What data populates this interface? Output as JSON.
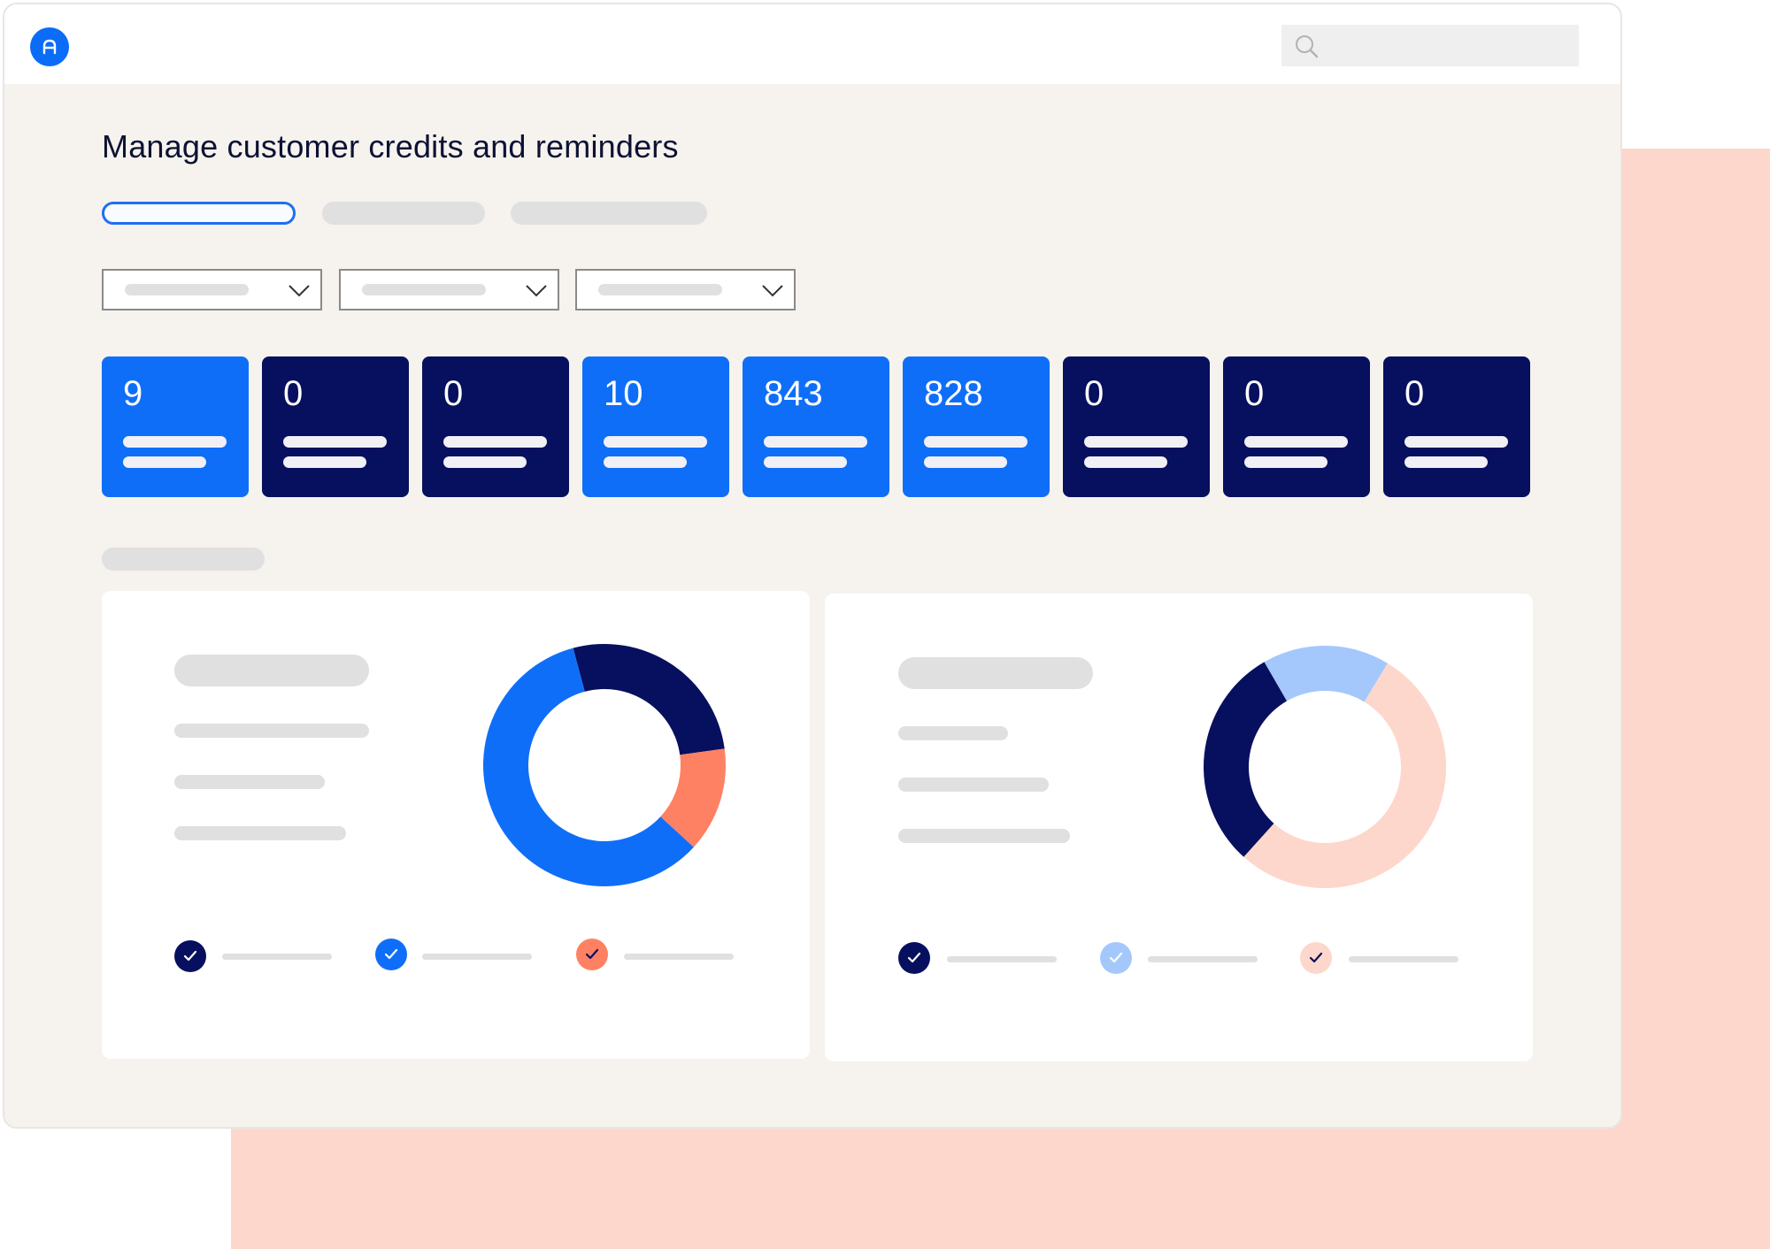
{
  "page": {
    "title": "Manage customer credits and reminders"
  },
  "topbar": {
    "logo_icon": "a-logo-icon",
    "search_icon": "search-icon"
  },
  "tabs": [
    {
      "active": true
    },
    {
      "active": false
    },
    {
      "active": false
    }
  ],
  "filters": [
    {
      "icon": "chevron-down-icon"
    },
    {
      "icon": "chevron-down-icon"
    },
    {
      "icon": "chevron-down-icon"
    }
  ],
  "kpis": [
    {
      "value": "9",
      "tone": "light"
    },
    {
      "value": "0",
      "tone": "dark"
    },
    {
      "value": "0",
      "tone": "dark"
    },
    {
      "value": "10",
      "tone": "light"
    },
    {
      "value": "843",
      "tone": "light"
    },
    {
      "value": "828",
      "tone": "light"
    },
    {
      "value": "0",
      "tone": "dark"
    },
    {
      "value": "0",
      "tone": "dark"
    },
    {
      "value": "0",
      "tone": "dark"
    }
  ],
  "colors": {
    "brand_blue": "#0f6ef8",
    "navy": "#07105e",
    "coral": "#ff8163",
    "light_blue": "#a4c8fc",
    "peach": "#fdd7cb",
    "canvas": "#f6f2ee"
  },
  "chart_data": [
    {
      "type": "pie",
      "donut": true,
      "slices": [
        {
          "value": 0.27,
          "color": "#07105e"
        },
        {
          "value": 0.14,
          "color": "#ff8163"
        },
        {
          "value": 0.59,
          "color": "#0f6ef8"
        }
      ],
      "legend": [
        {
          "color": "#07105e",
          "check": "#ffffff",
          "icon": "check-icon"
        },
        {
          "color": "#0f6ef8",
          "check": "#ffffff",
          "icon": "check-icon"
        },
        {
          "color": "#ff8163",
          "check": "#07105e",
          "icon": "check-icon"
        }
      ]
    },
    {
      "type": "pie",
      "donut": true,
      "slices": [
        {
          "value": 0.17,
          "color": "#a4c8fc"
        },
        {
          "value": 0.53,
          "color": "#fdd7cb"
        },
        {
          "value": 0.3,
          "color": "#07105e"
        }
      ],
      "legend": [
        {
          "color": "#07105e",
          "check": "#ffffff",
          "icon": "check-icon"
        },
        {
          "color": "#a4c8fc",
          "check": "#ffffff",
          "icon": "check-icon"
        },
        {
          "color": "#fdd7cb",
          "check": "#07105e",
          "icon": "check-icon"
        }
      ]
    }
  ]
}
